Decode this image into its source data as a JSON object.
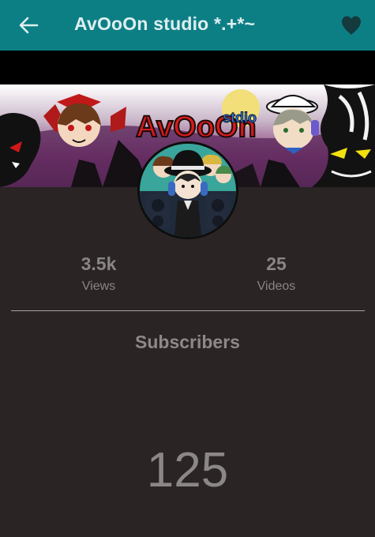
{
  "appbar": {
    "title": "AvOoOn studio *.+*~",
    "back_icon": "arrow-left-icon",
    "favorite_icon": "heart-icon"
  },
  "banner": {
    "logo_text": "AvOoOn",
    "logo_sub": "stdio"
  },
  "stats": {
    "views_value": "3.5k",
    "views_label": "Views",
    "videos_value": "25",
    "videos_label": "Videos"
  },
  "subscribers": {
    "label": "Subscribers",
    "count": "125"
  },
  "colors": {
    "appbar": "#0c7f85",
    "background": "#2a2424",
    "text_muted": "#8a8585"
  }
}
